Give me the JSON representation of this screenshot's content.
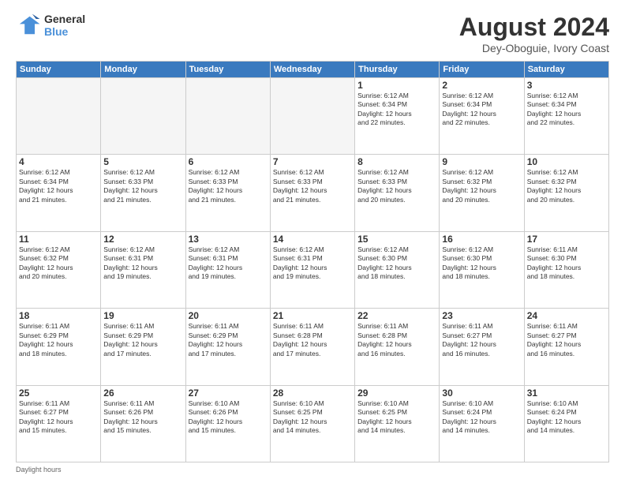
{
  "header": {
    "logo_line1": "General",
    "logo_line2": "Blue",
    "month_title": "August 2024",
    "subtitle": "Dey-Oboguie, Ivory Coast"
  },
  "days_of_week": [
    "Sunday",
    "Monday",
    "Tuesday",
    "Wednesday",
    "Thursday",
    "Friday",
    "Saturday"
  ],
  "weeks": [
    [
      {
        "day": "",
        "info": ""
      },
      {
        "day": "",
        "info": ""
      },
      {
        "day": "",
        "info": ""
      },
      {
        "day": "",
        "info": ""
      },
      {
        "day": "1",
        "info": "Sunrise: 6:12 AM\nSunset: 6:34 PM\nDaylight: 12 hours\nand 22 minutes."
      },
      {
        "day": "2",
        "info": "Sunrise: 6:12 AM\nSunset: 6:34 PM\nDaylight: 12 hours\nand 22 minutes."
      },
      {
        "day": "3",
        "info": "Sunrise: 6:12 AM\nSunset: 6:34 PM\nDaylight: 12 hours\nand 22 minutes."
      }
    ],
    [
      {
        "day": "4",
        "info": "Sunrise: 6:12 AM\nSunset: 6:34 PM\nDaylight: 12 hours\nand 21 minutes."
      },
      {
        "day": "5",
        "info": "Sunrise: 6:12 AM\nSunset: 6:33 PM\nDaylight: 12 hours\nand 21 minutes."
      },
      {
        "day": "6",
        "info": "Sunrise: 6:12 AM\nSunset: 6:33 PM\nDaylight: 12 hours\nand 21 minutes."
      },
      {
        "day": "7",
        "info": "Sunrise: 6:12 AM\nSunset: 6:33 PM\nDaylight: 12 hours\nand 21 minutes."
      },
      {
        "day": "8",
        "info": "Sunrise: 6:12 AM\nSunset: 6:33 PM\nDaylight: 12 hours\nand 20 minutes."
      },
      {
        "day": "9",
        "info": "Sunrise: 6:12 AM\nSunset: 6:32 PM\nDaylight: 12 hours\nand 20 minutes."
      },
      {
        "day": "10",
        "info": "Sunrise: 6:12 AM\nSunset: 6:32 PM\nDaylight: 12 hours\nand 20 minutes."
      }
    ],
    [
      {
        "day": "11",
        "info": "Sunrise: 6:12 AM\nSunset: 6:32 PM\nDaylight: 12 hours\nand 20 minutes."
      },
      {
        "day": "12",
        "info": "Sunrise: 6:12 AM\nSunset: 6:31 PM\nDaylight: 12 hours\nand 19 minutes."
      },
      {
        "day": "13",
        "info": "Sunrise: 6:12 AM\nSunset: 6:31 PM\nDaylight: 12 hours\nand 19 minutes."
      },
      {
        "day": "14",
        "info": "Sunrise: 6:12 AM\nSunset: 6:31 PM\nDaylight: 12 hours\nand 19 minutes."
      },
      {
        "day": "15",
        "info": "Sunrise: 6:12 AM\nSunset: 6:30 PM\nDaylight: 12 hours\nand 18 minutes."
      },
      {
        "day": "16",
        "info": "Sunrise: 6:12 AM\nSunset: 6:30 PM\nDaylight: 12 hours\nand 18 minutes."
      },
      {
        "day": "17",
        "info": "Sunrise: 6:11 AM\nSunset: 6:30 PM\nDaylight: 12 hours\nand 18 minutes."
      }
    ],
    [
      {
        "day": "18",
        "info": "Sunrise: 6:11 AM\nSunset: 6:29 PM\nDaylight: 12 hours\nand 18 minutes."
      },
      {
        "day": "19",
        "info": "Sunrise: 6:11 AM\nSunset: 6:29 PM\nDaylight: 12 hours\nand 17 minutes."
      },
      {
        "day": "20",
        "info": "Sunrise: 6:11 AM\nSunset: 6:29 PM\nDaylight: 12 hours\nand 17 minutes."
      },
      {
        "day": "21",
        "info": "Sunrise: 6:11 AM\nSunset: 6:28 PM\nDaylight: 12 hours\nand 17 minutes."
      },
      {
        "day": "22",
        "info": "Sunrise: 6:11 AM\nSunset: 6:28 PM\nDaylight: 12 hours\nand 16 minutes."
      },
      {
        "day": "23",
        "info": "Sunrise: 6:11 AM\nSunset: 6:27 PM\nDaylight: 12 hours\nand 16 minutes."
      },
      {
        "day": "24",
        "info": "Sunrise: 6:11 AM\nSunset: 6:27 PM\nDaylight: 12 hours\nand 16 minutes."
      }
    ],
    [
      {
        "day": "25",
        "info": "Sunrise: 6:11 AM\nSunset: 6:27 PM\nDaylight: 12 hours\nand 15 minutes."
      },
      {
        "day": "26",
        "info": "Sunrise: 6:11 AM\nSunset: 6:26 PM\nDaylight: 12 hours\nand 15 minutes."
      },
      {
        "day": "27",
        "info": "Sunrise: 6:10 AM\nSunset: 6:26 PM\nDaylight: 12 hours\nand 15 minutes."
      },
      {
        "day": "28",
        "info": "Sunrise: 6:10 AM\nSunset: 6:25 PM\nDaylight: 12 hours\nand 14 minutes."
      },
      {
        "day": "29",
        "info": "Sunrise: 6:10 AM\nSunset: 6:25 PM\nDaylight: 12 hours\nand 14 minutes."
      },
      {
        "day": "30",
        "info": "Sunrise: 6:10 AM\nSunset: 6:24 PM\nDaylight: 12 hours\nand 14 minutes."
      },
      {
        "day": "31",
        "info": "Sunrise: 6:10 AM\nSunset: 6:24 PM\nDaylight: 12 hours\nand 14 minutes."
      }
    ]
  ],
  "footer": "Daylight hours"
}
